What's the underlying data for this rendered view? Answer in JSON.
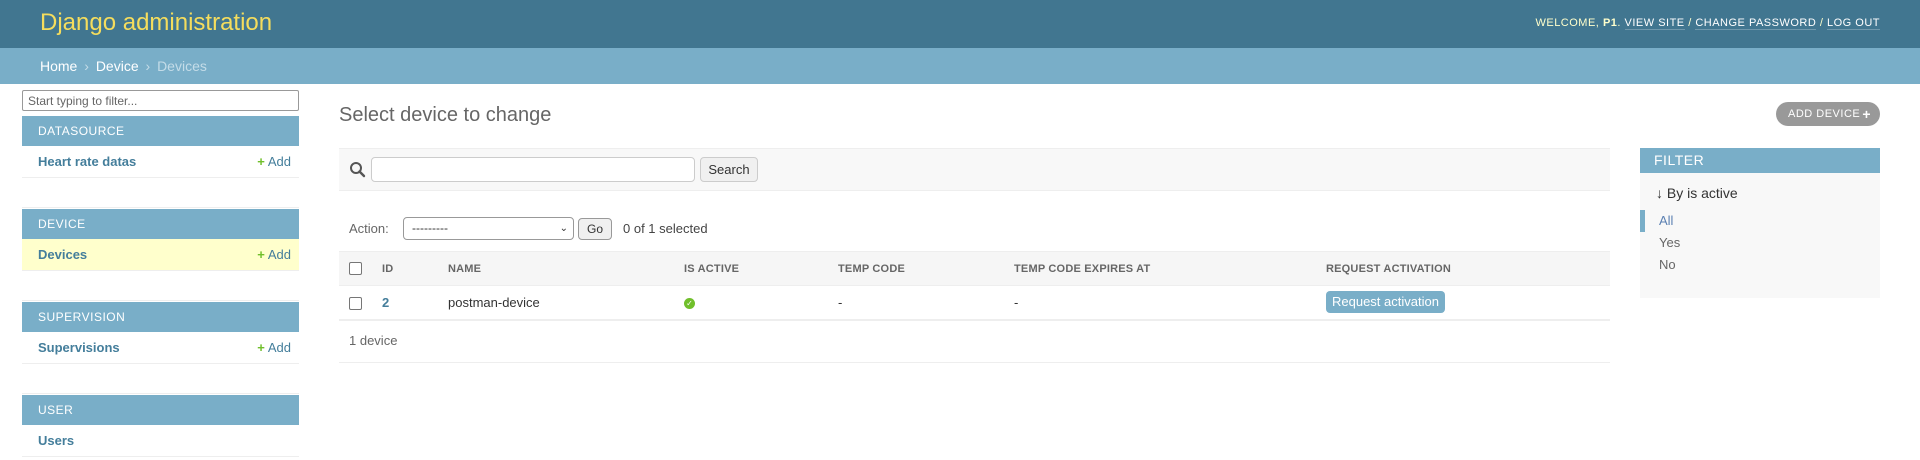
{
  "header": {
    "branding": "Django administration",
    "welcome": "Welcome,",
    "username": "P1",
    "view_site": "View site",
    "change_password": "Change password",
    "log_out": "Log out"
  },
  "breadcrumbs": {
    "home": "Home",
    "app": "Device",
    "current": "Devices",
    "sep": "›"
  },
  "sidebar": {
    "filter_placeholder": "Start typing to filter...",
    "add_label": "Add",
    "apps": [
      {
        "caption": "Datasource",
        "model": "Heart rate datas",
        "has_add": true
      },
      {
        "caption": "Device",
        "model": "Devices",
        "has_add": true,
        "current": true
      },
      {
        "caption": "Supervision",
        "model": "Supervisions",
        "has_add": true
      },
      {
        "caption": "User",
        "model": "Users",
        "has_add": false
      }
    ]
  },
  "content": {
    "title": "Select device to change",
    "add_button": "Add device",
    "search_button": "Search",
    "action_label": "Action:",
    "action_selected": "---------",
    "go_button": "Go",
    "selection_counter": "0 of 1 selected"
  },
  "table": {
    "columns": [
      "ID",
      "Name",
      "Is active",
      "Temp code",
      "Temp code expires at",
      "Request activation"
    ],
    "rows": [
      {
        "id": "2",
        "name": "postman-device",
        "is_active": true,
        "temp_code": "-",
        "temp_code_expires_at": "-",
        "action": "Request activation"
      }
    ]
  },
  "paginator": "1 device",
  "filter": {
    "title": "Filter",
    "by": "↓ By is active",
    "options": [
      {
        "label": "All",
        "selected": true
      },
      {
        "label": "Yes",
        "selected": false
      },
      {
        "label": "No",
        "selected": false
      }
    ]
  },
  "colors": {
    "header_bg": "#417690",
    "branding": "#f5dd5d",
    "breadcrumb_bg": "#79aec8",
    "link": "#447e9b",
    "add_green": "#70bf2b",
    "current_row": "#ffffcc"
  }
}
